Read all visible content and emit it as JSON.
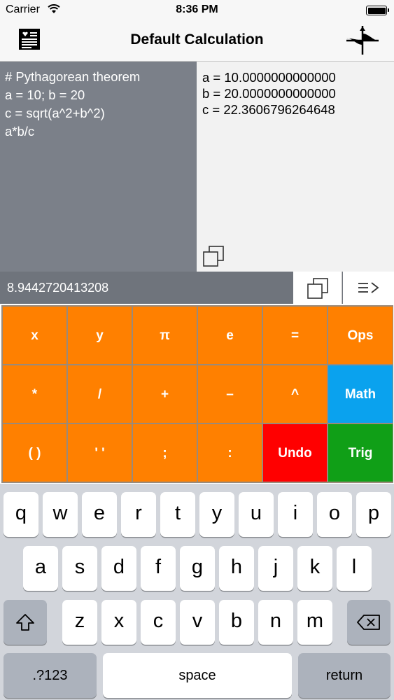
{
  "status_bar": {
    "carrier": "Carrier",
    "time": "8:36 PM"
  },
  "nav": {
    "title": "Default Calculation",
    "left_icon": "notes-list-icon",
    "right_icon": "graph-plot-icon"
  },
  "editor": {
    "input_lines": [
      "# Pythagorean theorem",
      "a = 10; b = 20",
      "c = sqrt(a^2+b^2)",
      "a*b/c"
    ],
    "output_lines": [
      "a = 10.0000000000000",
      "b = 20.0000000000000",
      "c = 22.3606796264648"
    ]
  },
  "result": {
    "value": "8.9442720413208"
  },
  "keypad": {
    "rows": [
      [
        "x",
        "y",
        "π",
        "e",
        "=",
        "Ops"
      ],
      [
        "*",
        "/",
        "+",
        "–",
        "^",
        "Math"
      ],
      [
        "( )",
        "' '",
        ";",
        ":",
        "Undo",
        "Trig"
      ]
    ],
    "colors": {
      "orange": "#ff8000",
      "blue": "#0aa2ee",
      "red": "#ff0000",
      "green": "#109f17"
    }
  },
  "keyboard": {
    "row1": [
      "q",
      "w",
      "e",
      "r",
      "t",
      "y",
      "u",
      "i",
      "o",
      "p"
    ],
    "row2": [
      "a",
      "s",
      "d",
      "f",
      "g",
      "h",
      "j",
      "k",
      "l"
    ],
    "row3": [
      "z",
      "x",
      "c",
      "v",
      "b",
      "n",
      "m"
    ],
    "mode_key": ".?123",
    "space_key": "space",
    "return_key": "return"
  }
}
